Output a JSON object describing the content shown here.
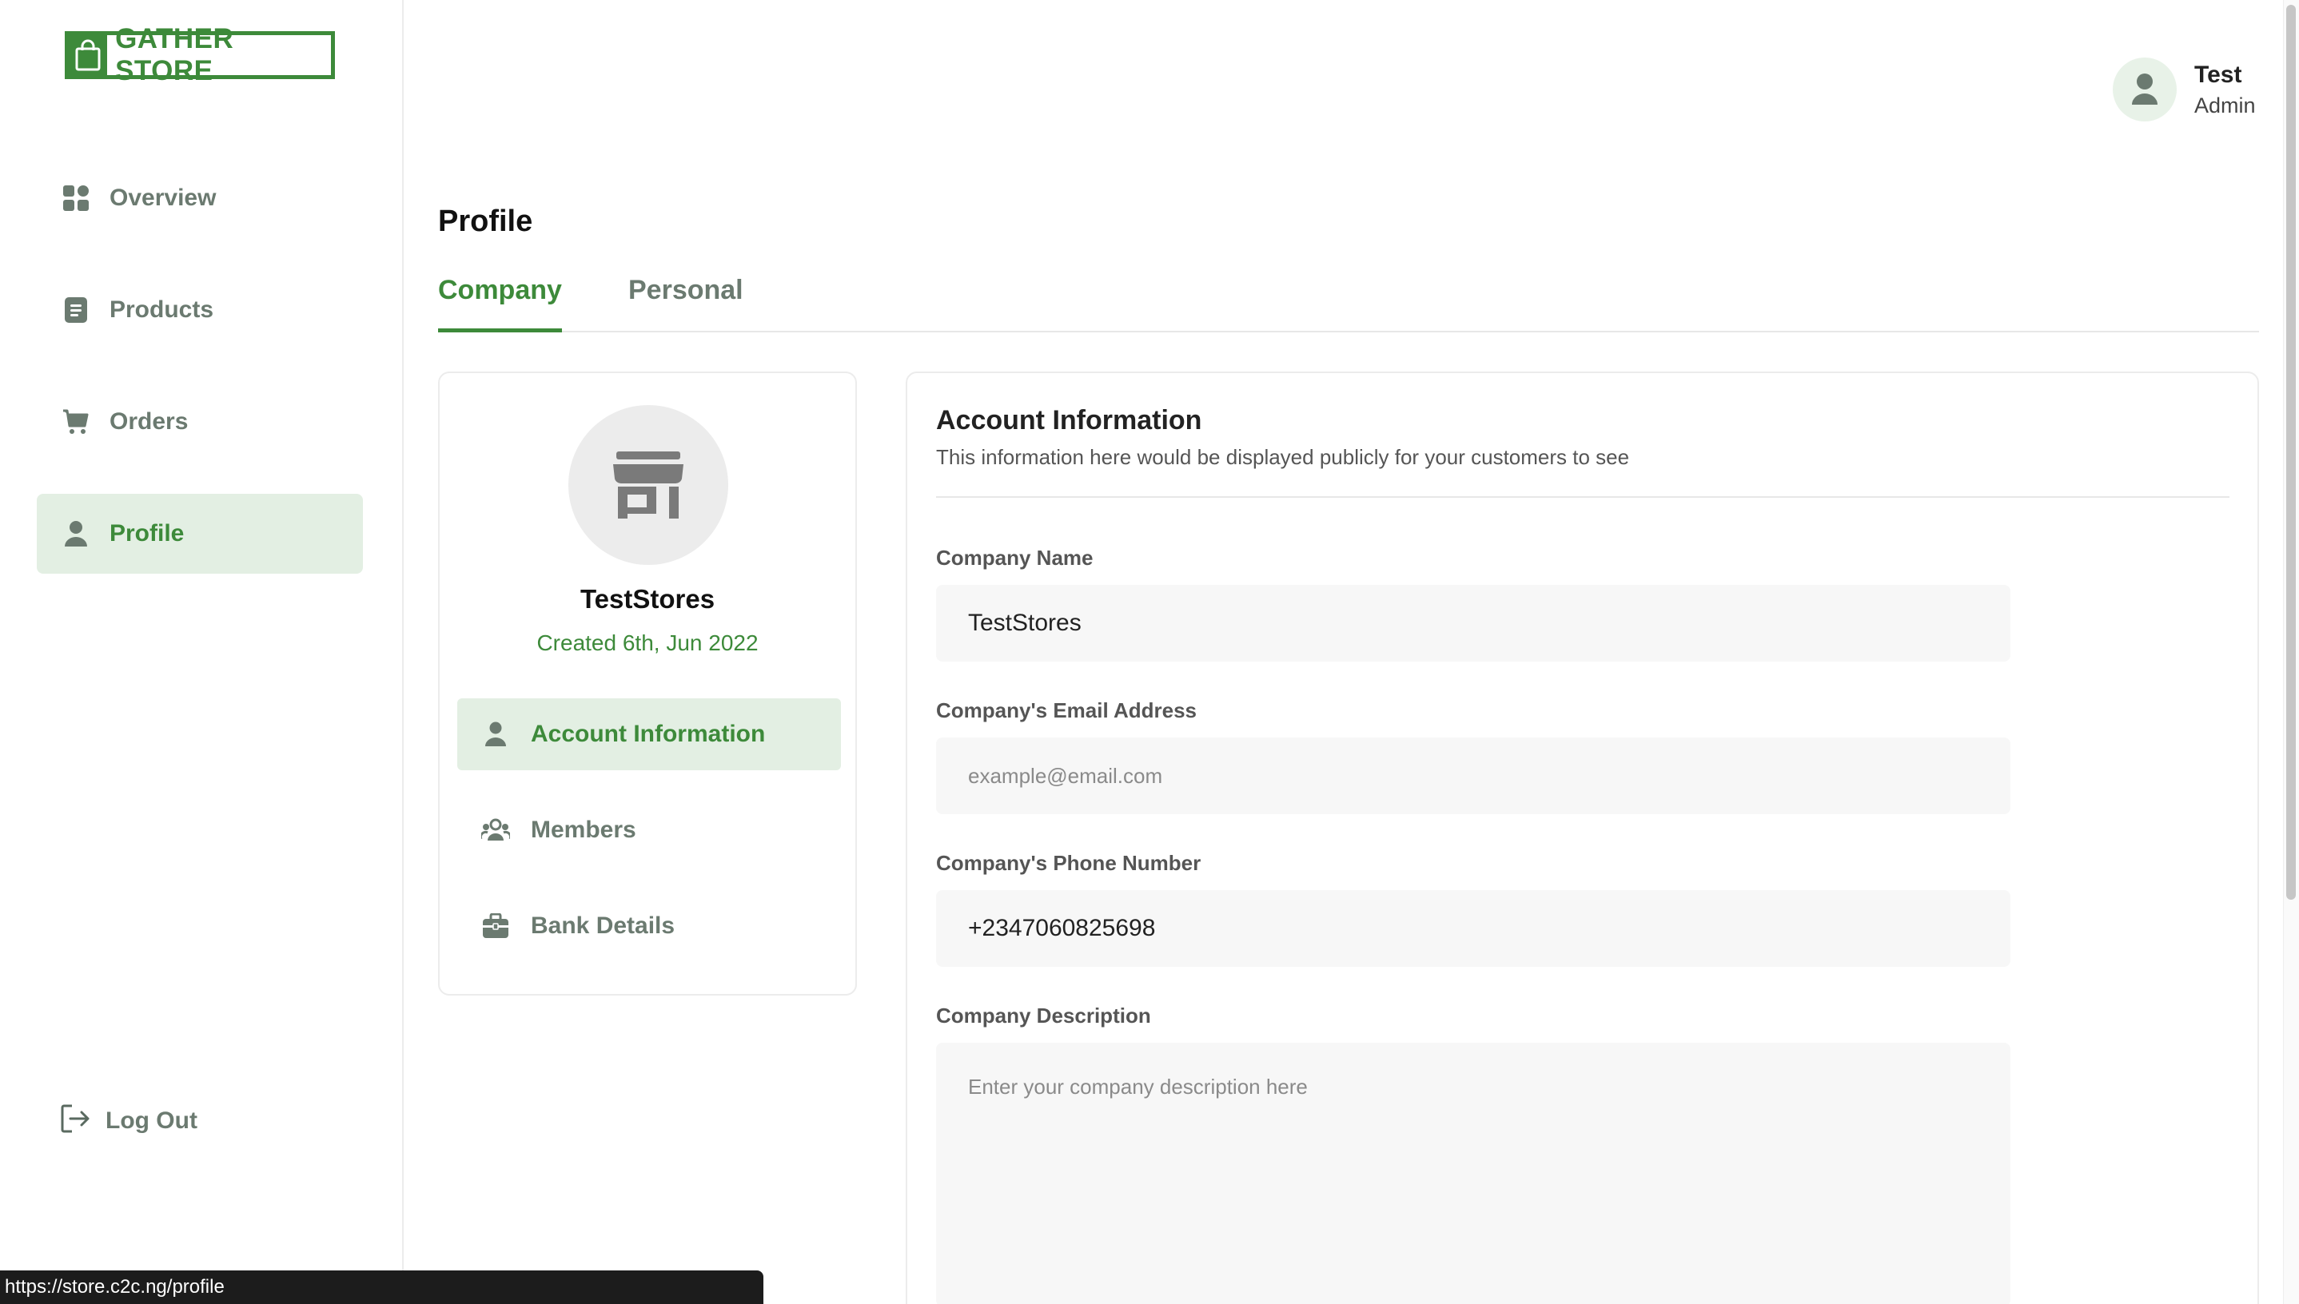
{
  "brand": {
    "name": "GATHER STORE"
  },
  "sidebar": {
    "items": [
      {
        "label": "Overview",
        "icon": "grid-icon"
      },
      {
        "label": "Products",
        "icon": "document-icon"
      },
      {
        "label": "Orders",
        "icon": "cart-icon"
      },
      {
        "label": "Profile",
        "icon": "user-icon",
        "active": true
      }
    ],
    "logout_label": "Log Out"
  },
  "user": {
    "name": "Test",
    "role": "Admin"
  },
  "page": {
    "title": "Profile",
    "tabs": [
      {
        "label": "Company",
        "active": true
      },
      {
        "label": "Personal"
      }
    ]
  },
  "profile_card": {
    "store_name": "TestStores",
    "created": "Created 6th, Jun 2022",
    "menu": [
      {
        "label": "Account Information",
        "icon": "user-icon",
        "active": true
      },
      {
        "label": "Members",
        "icon": "users-icon"
      },
      {
        "label": "Bank Details",
        "icon": "briefcase-icon"
      }
    ]
  },
  "account_form": {
    "title": "Account Information",
    "subtitle": "This information here would be displayed publicly for your customers to see",
    "company_name": {
      "label": "Company Name",
      "value": "TestStores"
    },
    "email": {
      "label": "Company's Email Address",
      "value": "",
      "placeholder": "example@email.com"
    },
    "phone": {
      "label": "Company's Phone Number",
      "value": "+2347060825698"
    },
    "description": {
      "label": "Company Description",
      "value": "",
      "placeholder": "Enter your company description here"
    }
  },
  "statusbar": {
    "url": "https://store.c2c.ng/profile"
  },
  "colors": {
    "accent": "#3d8a3a",
    "accent_light": "#e3efe3",
    "muted": "#6b7a70"
  }
}
